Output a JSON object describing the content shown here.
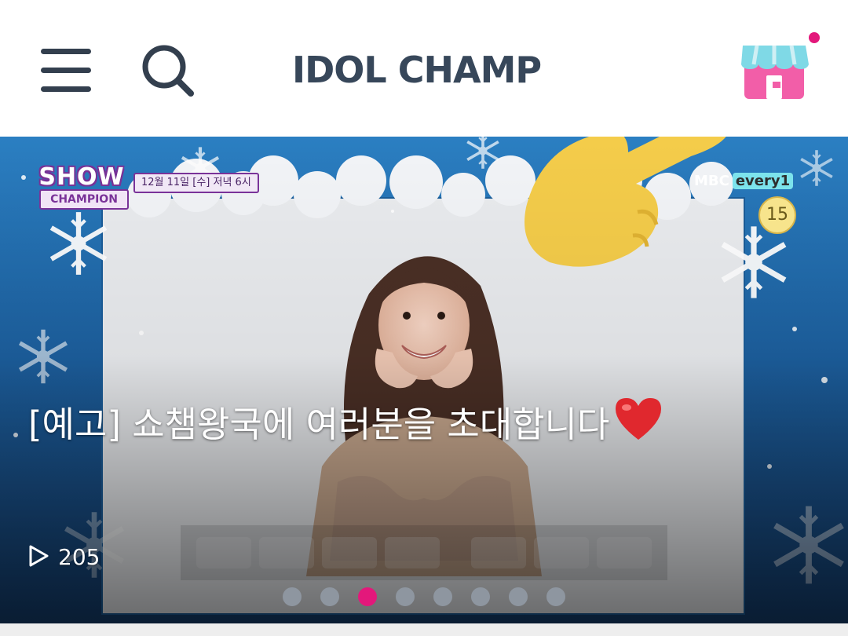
{
  "header": {
    "logo": "IDOL CHAMP",
    "icons": {
      "menu": "hamburger-menu-icon",
      "search": "search-icon",
      "shop": "shop-icon"
    },
    "notification_color": "#e3187b"
  },
  "banner": {
    "show_logo_line1": "SHOW",
    "show_logo_line2": "CHAMPION",
    "airtime": "12월 11일 [수] 저녁 6시",
    "network_mbc": "MBC",
    "network_every": "every1",
    "rating": "15",
    "title": "[예고] 쇼챔왕국에 여러분을 초대합니다",
    "view_count": "205",
    "slide_count": 8,
    "active_slide": 3,
    "accent_color": "#e3187b"
  }
}
